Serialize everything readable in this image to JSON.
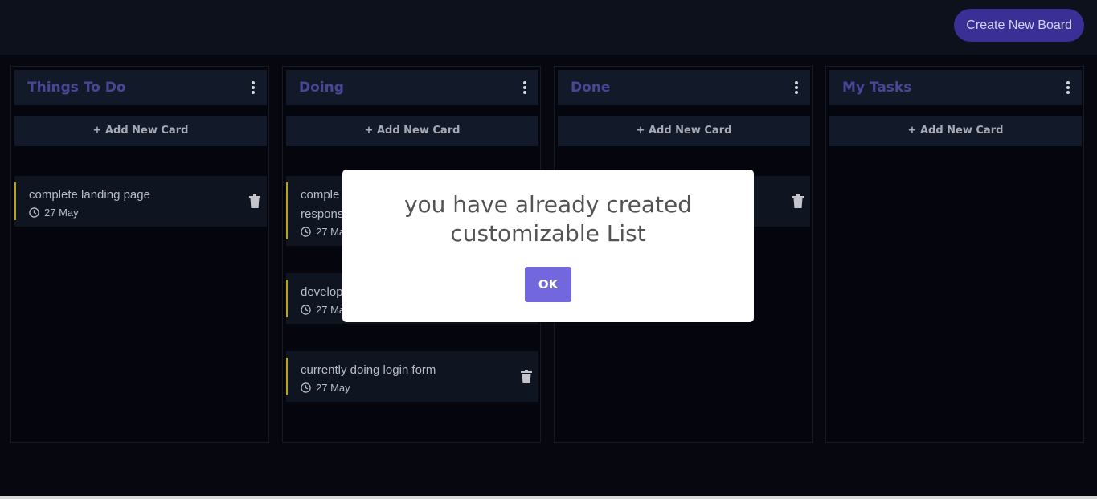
{
  "header": {
    "create_board_label": "Create New Board"
  },
  "columns": [
    {
      "title": "Things To Do",
      "add_label": "+ Add New Card",
      "cards": [
        {
          "title": "complete landing page",
          "date": "27 May"
        }
      ]
    },
    {
      "title": "Doing",
      "add_label": "+ Add New Card",
      "cards": [
        {
          "title": "comple responsi",
          "date": "27 Ma"
        },
        {
          "title": "develop",
          "date": "27 Ma"
        },
        {
          "title": "currently doing login form",
          "date": "27 May"
        }
      ]
    },
    {
      "title": "Done",
      "add_label": "+ Add New Card",
      "cards": []
    },
    {
      "title": "My Tasks",
      "add_label": "+ Add New Card",
      "cards": []
    }
  ],
  "modal": {
    "line1": "you have already created",
    "line2": "customizable List",
    "ok_label": "OK"
  },
  "icons": {
    "menu": "kebab-menu-icon",
    "date": "clock-icon",
    "delete": "trash-icon"
  },
  "colors": {
    "accent": "#3a2f95",
    "title": "#4a4596",
    "card_bar": "#b6a51d",
    "ok": "#7267dc"
  }
}
